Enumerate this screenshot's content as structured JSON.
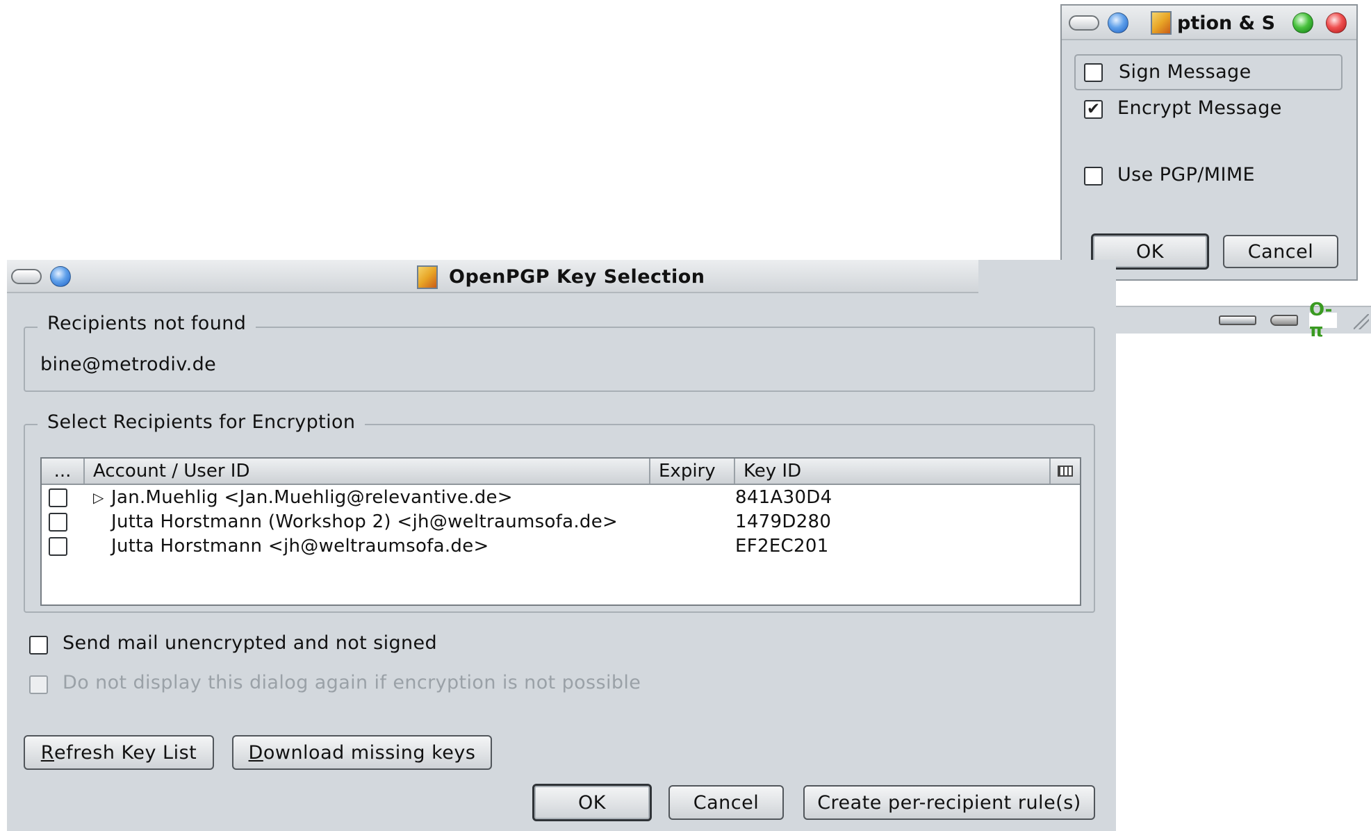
{
  "small_dialog": {
    "title": "ption & S",
    "sign_label": "Sign Message",
    "sign_checked": false,
    "encrypt_label": "Encrypt Message",
    "encrypt_checked": true,
    "pgpmime_label": "Use PGP/MIME",
    "pgpmime_checked": false,
    "ok_label": "OK",
    "cancel_label": "Cancel"
  },
  "status_bar": {
    "icons": [
      "connection-plug-icon",
      "signing-pen-icon",
      "encryption-key-icon"
    ],
    "key_glyph": "O-π"
  },
  "main_dialog": {
    "title": "OpenPGP Key Selection",
    "not_found": {
      "legend": "Recipients not found",
      "email": "bine@metrodiv.de"
    },
    "select": {
      "legend": "Select Recipients for Encryption",
      "columns": [
        "...",
        "Account / User ID",
        "Expiry",
        "Key ID"
      ],
      "rows": [
        {
          "checked": false,
          "expandable": true,
          "user_id": "Jan.Muehlig <Jan.Muehlig@relevantive.de>",
          "expiry": "",
          "key_id": "841A30D4"
        },
        {
          "checked": false,
          "expandable": false,
          "user_id": "Jutta Horstmann (Workshop 2) <jh@weltraumsofa.de>",
          "expiry": "",
          "key_id": "1479D280"
        },
        {
          "checked": false,
          "expandable": false,
          "user_id": "Jutta Horstmann <jh@weltraumsofa.de>",
          "expiry": "",
          "key_id": "EF2EC201"
        }
      ]
    },
    "send_unencrypted_label": "Send mail unencrypted and not signed",
    "do_not_display_label": "Do not display this dialog again if encryption is not possible",
    "refresh_button": {
      "mnemonic": "R",
      "rest": "efresh Key List"
    },
    "download_button": {
      "mnemonic": "D",
      "rest": "ownload missing keys"
    },
    "ok_label": "OK",
    "cancel_label": "Cancel",
    "rules_label": "Create per-recipient rule(s)"
  },
  "colors": {
    "dialog_bg": "#d3d8dd",
    "titlebar_bg": "#dfe3e6",
    "accent_key": "#3a9a21"
  }
}
